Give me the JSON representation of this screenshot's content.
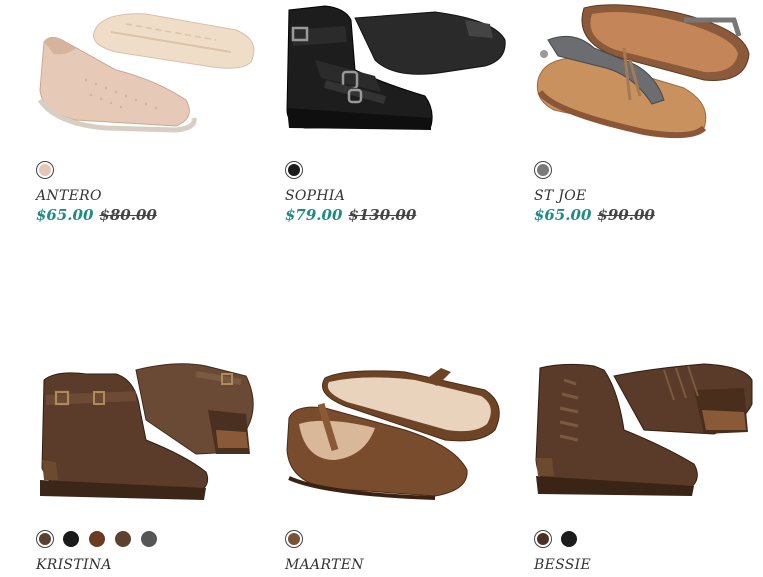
{
  "colors": {
    "accent": "#1f8a86",
    "text": "#333333"
  },
  "products": [
    {
      "name": "ANTERO",
      "sale_price": "$65.00",
      "original_price": "$80.00",
      "swatches": [
        "#e4c8b6"
      ],
      "image": "beige-knit-slip-on-shoe"
    },
    {
      "name": "SOPHIA",
      "sale_price": "$79.00",
      "original_price": "$130.00",
      "swatches": [
        "#1c1c1c"
      ],
      "image": "black-buckle-high-top-boot"
    },
    {
      "name": "ST JOE",
      "sale_price": "$65.00",
      "original_price": "$90.00",
      "swatches": [
        "#7a7a7a"
      ],
      "image": "grey-tassel-thong-sandal"
    },
    {
      "name": "KRISTINA",
      "swatches": [
        "#5a4030",
        "#1a1a1a",
        "#6b3a22",
        "#5e4030",
        "#555555"
      ],
      "image": "brown-buckle-ankle-bootie"
    },
    {
      "name": "MAARTEN",
      "swatches": [
        "#7a5236"
      ],
      "image": "brown-mary-jane-flat"
    },
    {
      "name": "BESSIE",
      "swatches": [
        "#4a3124",
        "#1c1c1c"
      ],
      "image": "brown-lace-side-ankle-bootie"
    }
  ]
}
